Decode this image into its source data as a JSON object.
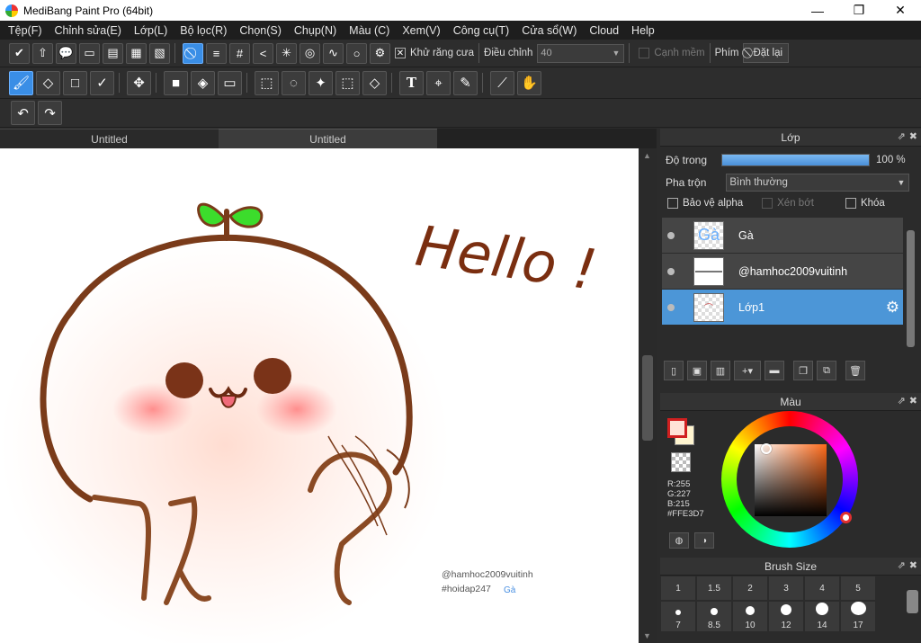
{
  "window": {
    "title": "MediBang Paint Pro (64bit)",
    "minimize": "—",
    "maximize": "❐",
    "close": "✕"
  },
  "menu": [
    "Tệp(F)",
    "Chỉnh sửa(E)",
    "Lớp(L)",
    "Bộ lọc(R)",
    "Chọn(S)",
    "Chụp(N)",
    "Màu (C)",
    "Xem(V)",
    "Công cụ(T)",
    "Cửa sổ(W)",
    "Cloud",
    "Help"
  ],
  "toolbar1": {
    "antialias_label": "Khử răng cưa",
    "adjust_label": "Điều chỉnh",
    "adjust_value": "40",
    "soft_edge_label": "Cạnh mềm",
    "key_label": "Phím",
    "reset_label": "Đặt lại"
  },
  "tabs": [
    "Untitled",
    "Untitled"
  ],
  "canvas": {
    "hello_text": "Hello !",
    "credit_line1": "@hamhoc2009vuitinh",
    "credit_line2": "#hoidap247",
    "credit_tag": "Gà"
  },
  "layer_panel": {
    "title": "Lớp",
    "opacity_label": "Độ trong",
    "opacity_value": "100 %",
    "opacity": 1.0,
    "blend_label": "Pha trộn",
    "blend_value": "Bình thường",
    "protect_alpha": "Bảo vệ alpha",
    "clipping": "Xén bớt",
    "lock": "Khóa",
    "layers": [
      {
        "name": "Gà",
        "thumb": "Gà",
        "selected": false
      },
      {
        "name": "@hamhoc2009vuitinh",
        "thumb": "",
        "selected": false
      },
      {
        "name": "Lớp1",
        "thumb": "",
        "selected": true
      }
    ]
  },
  "color_panel": {
    "title": "Màu",
    "r": "R:255",
    "g": "G:227",
    "b": "B:215",
    "hex": "#FFE3D7",
    "fg_color": "#ffe3d7"
  },
  "brush_panel": {
    "title": "Brush Size",
    "sizes_row1": [
      "1",
      "1.5",
      "2",
      "3",
      "4",
      "5"
    ],
    "sizes_row2": [
      "7",
      "8.5",
      "10",
      "12",
      "14",
      "17"
    ]
  }
}
